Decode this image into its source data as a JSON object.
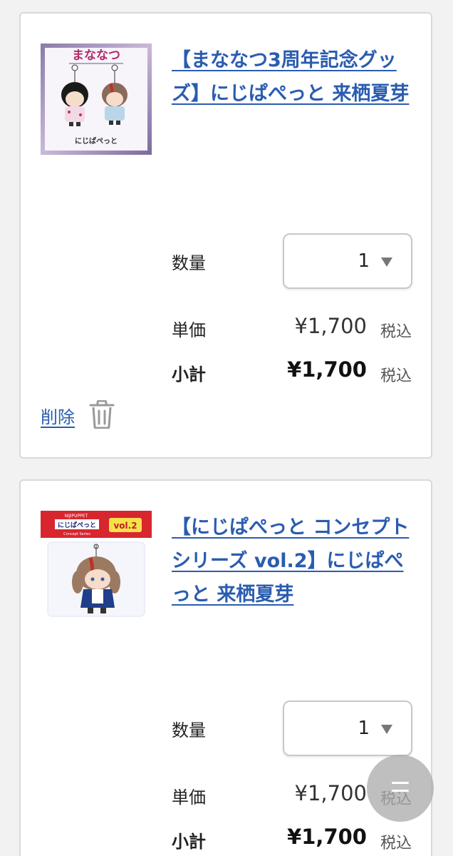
{
  "items": [
    {
      "title": "【まななつ3周年記念グッズ】にじぱぺっと 来栖夏芽",
      "thumb": {
        "logo_text": "まななつ",
        "caption": "にじぱぺっと"
      },
      "quantity_label": "数量",
      "quantity_value": "1",
      "unit_price_label": "単価",
      "unit_price": "¥1,700",
      "unit_tax": "税込",
      "subtotal_label": "小計",
      "subtotal": "¥1,700",
      "subtotal_tax": "税込",
      "delete_label": "削除"
    },
    {
      "title": "【にじぱぺっと コンセプトシリーズ vol.2】にじぱぺっと 来栖夏芽",
      "thumb": {
        "banner_small": "NIJIPUPPET",
        "banner_text": "にじぱぺっと",
        "banner_sub": "Concept Series",
        "vol_text": "vol.2"
      },
      "quantity_label": "数量",
      "quantity_value": "1",
      "unit_price_label": "単価",
      "unit_price": "¥1,700",
      "unit_tax": "税込",
      "subtotal_label": "小計",
      "subtotal": "¥1,700",
      "subtotal_tax": "税込"
    }
  ],
  "icons": {
    "trash": "trash-icon",
    "caret": "chevron-down-icon",
    "fab": "menu-icon"
  },
  "colors": {
    "link": "#2a5cb0",
    "card_border": "#d9d9d9",
    "background": "#f2f2f2"
  }
}
